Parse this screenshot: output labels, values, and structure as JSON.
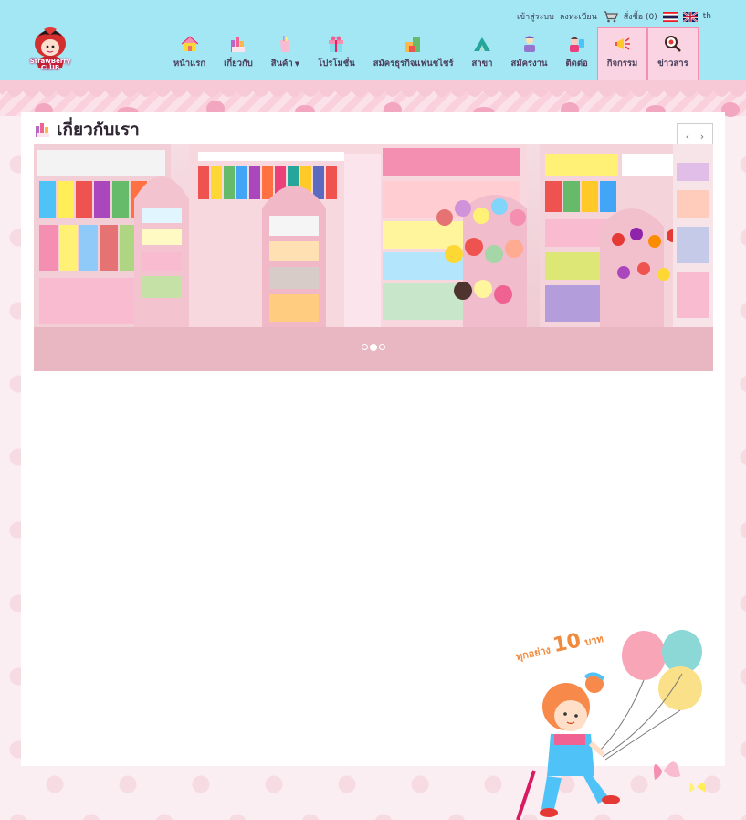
{
  "header": {
    "logo_text": "StrawBerry CLUB",
    "top_links": {
      "login": "เข้าสู่ระบบ",
      "register": "ลงทะเบียน",
      "order_label": "สั่งซื้อ",
      "order_count": "(0)",
      "lang": "th"
    },
    "nav": [
      {
        "label": "หน้าแรก",
        "icon": "house-icon"
      },
      {
        "label": "เกี่ยวกับ",
        "icon": "crayons-icon"
      },
      {
        "label": "สินค้า",
        "icon": "cup-icon",
        "has_dropdown": true
      },
      {
        "label": "โปรโมชั่น",
        "icon": "gift-icon"
      },
      {
        "label": "สมัครธุรกิจแฟนชไชร์",
        "icon": "blocks-icon"
      },
      {
        "label": "สาขา",
        "icon": "tent-icon"
      },
      {
        "label": "สมัครงาน",
        "icon": "worker-icon"
      },
      {
        "label": "ติดต่อ",
        "icon": "contact-icon"
      },
      {
        "label": "กิจกรรม",
        "icon": "megaphone-icon",
        "active": true
      },
      {
        "label": "ข่าวสาร",
        "icon": "magnifier-icon"
      }
    ],
    "active_color": "#fad4e2"
  },
  "page": {
    "title": "เกี่ยวกับเรา",
    "title_icon": "crayons-icon",
    "prev_label": "‹",
    "next_label": "›",
    "slides_total": 3,
    "slide_active": 2
  },
  "promo": {
    "text_prefix": "ทุกอย่าง",
    "text_price": "10",
    "text_unit": "บาท"
  },
  "colors": {
    "header_bg": "#a3e7f5",
    "page_bg": "#fbeef2",
    "content_bg": "#ffffff",
    "accent_pink": "#f48fb1"
  }
}
